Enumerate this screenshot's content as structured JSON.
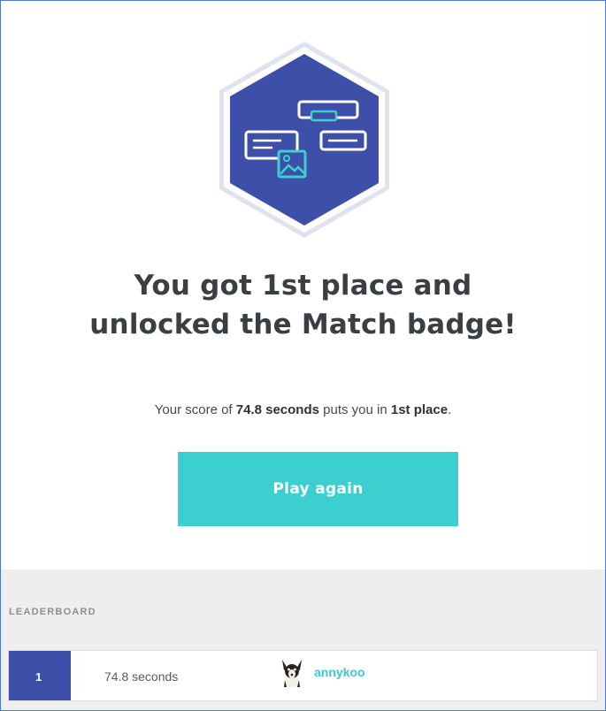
{
  "result": {
    "headline_line1": "You got 1st place and",
    "headline_line2": "unlocked the Match badge!",
    "score_prefix": "Your score of ",
    "score_value": "74.8 seconds",
    "score_middle": " puts you in ",
    "place": "1st place",
    "score_suffix": "."
  },
  "actions": {
    "play_again_label": "Play again"
  },
  "leaderboard": {
    "title": "LEADERBOARD",
    "rows": [
      {
        "rank": "1",
        "score": "74.8 seconds",
        "username": "annykoo"
      }
    ]
  },
  "colors": {
    "badge_fill": "#3d4fa8",
    "badge_border": "#d9ddea",
    "accent": "#3ccfcf",
    "rank_bg": "#3d4fa8",
    "username": "#3cc7d0"
  },
  "icons": {
    "badge": "match-badge-icon",
    "avatar": "dog-avatar"
  }
}
